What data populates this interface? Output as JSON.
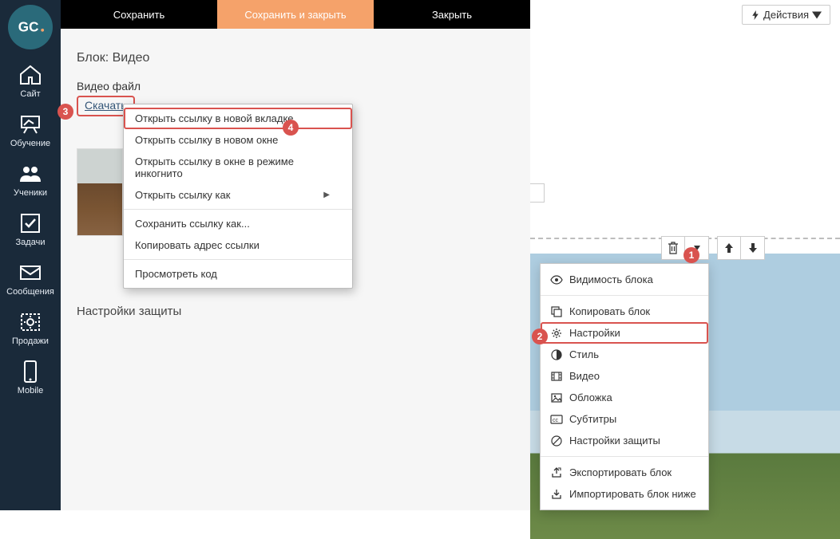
{
  "logo_text": "GC.",
  "sidebar": {
    "items": [
      {
        "label": "Сайт",
        "icon": "house-icon"
      },
      {
        "label": "Обучение",
        "icon": "board-icon"
      },
      {
        "label": "Ученики",
        "icon": "users-icon"
      },
      {
        "label": "Задачи",
        "icon": "check-icon"
      },
      {
        "label": "Сообщения",
        "icon": "mail-icon"
      },
      {
        "label": "Продажи",
        "icon": "gear-box-icon"
      },
      {
        "label": "Mobile",
        "icon": "phone-icon"
      }
    ]
  },
  "toolbar": {
    "save": "Сохранить",
    "save_close": "Сохранить и закрыть",
    "close": "Закрыть"
  },
  "actions_button": "Действия",
  "editor": {
    "block_title": "Блок: Видео",
    "video_file_label": "Видео файл",
    "download_label": "Скачать",
    "settings_title": "Настройки защиты"
  },
  "context_menu": {
    "open_new_tab": "Открыть ссылку в новой вкладке",
    "open_new_window": "Открыть ссылку в новом окне",
    "open_incognito": "Открыть ссылку в окне в режиме инкогнито",
    "open_as": "Открыть ссылку как",
    "save_link_as": "Сохранить ссылку как...",
    "copy_link": "Копировать адрес ссылки",
    "inspect": "Просмотреть код"
  },
  "dropdown": {
    "visibility": "Видимость блока",
    "copy_block": "Копировать блок",
    "settings": "Настройки",
    "style": "Стиль",
    "video": "Видео",
    "cover": "Обложка",
    "subtitles": "Субтитры",
    "protection": "Настройки защиты",
    "export": "Экспортировать блок",
    "import_below": "Импортировать блок ниже"
  },
  "annotations": {
    "b1": "1",
    "b2": "2",
    "b3": "3",
    "b4": "4"
  }
}
